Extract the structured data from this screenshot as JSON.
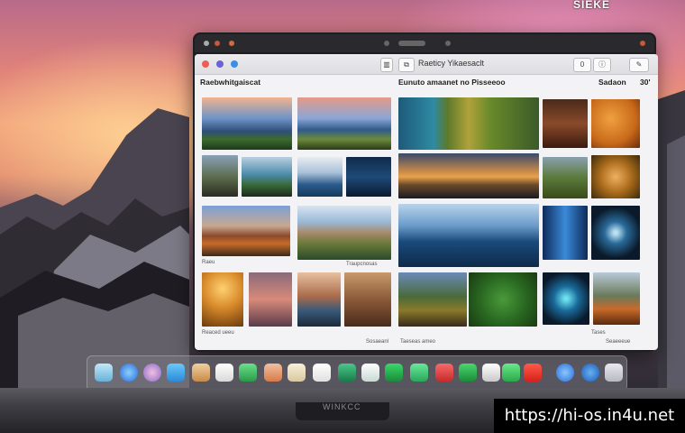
{
  "corner_text": "SIEKE",
  "window": {
    "title": "Raeticy Yikaesaclt",
    "toolbar_count": "0",
    "left_section_title": "Raebwhitgaiscat",
    "middle_section_title": "Eunuto amaanet no Pisseeoo",
    "right_section_title": "Sadaon",
    "right_section_count": "30'",
    "captions": {
      "left_row3": "Raeu",
      "mid_row3": "Traupcnosas",
      "left_row4": "Reaced ueeu",
      "mid_row4": "Sosaeanl",
      "center_row4": "Taeseas ameo",
      "right_row4a": "Tases",
      "right_row4b": "Seaeeeue"
    }
  },
  "icons": {
    "sidebar": "sidebar-icon",
    "share": "share-icon",
    "info": "info-icon",
    "edit": "edit-icon"
  },
  "laptop_label": "WINKCC",
  "watermark": "https://hi-os.in4u.net",
  "colors": {
    "accent_red": "#ee5e58",
    "accent_blue": "#3b8ee6",
    "window_bg": "#f3f3f5"
  }
}
